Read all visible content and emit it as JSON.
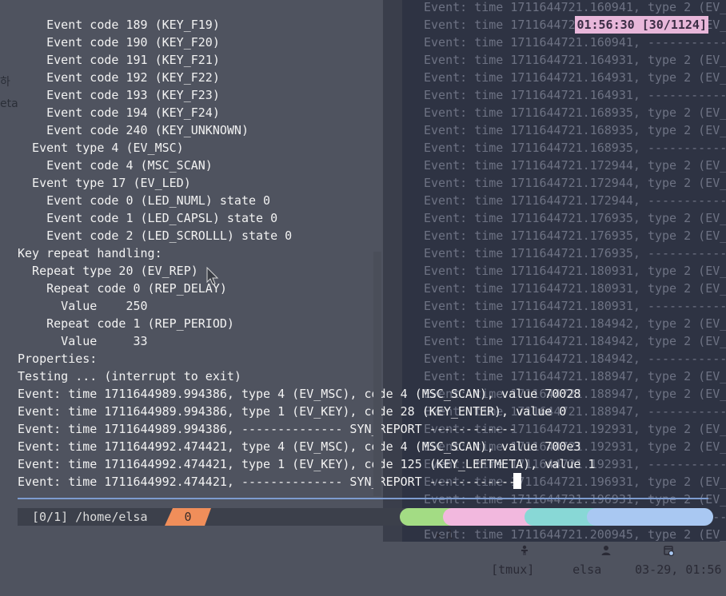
{
  "terminal": {
    "lines": [
      "    Event code 189 (KEY_F19)",
      "    Event code 190 (KEY_F20)",
      "    Event code 191 (KEY_F21)",
      "    Event code 192 (KEY_F22)",
      "    Event code 193 (KEY_F23)",
      "    Event code 194 (KEY_F24)",
      "    Event code 240 (KEY_UNKNOWN)",
      "  Event type 4 (EV_MSC)",
      "    Event code 4 (MSC_SCAN)",
      "  Event type 17 (EV_LED)",
      "    Event code 0 (LED_NUML) state 0",
      "    Event code 1 (LED_CAPSL) state 0",
      "    Event code 2 (LED_SCROLLL) state 0",
      "Key repeat handling:",
      "  Repeat type 20 (EV_REP)",
      "    Repeat code 0 (REP_DELAY)",
      "      Value    250",
      "    Repeat code 1 (REP_PERIOD)",
      "      Value     33",
      "Properties:",
      "Testing ... (interrupt to exit)",
      "Event: time 1711644989.994386, type 4 (EV_MSC), code 4 (MSC_SCAN), value 70028",
      "Event: time 1711644989.994386, type 1 (EV_KEY), code 28 (KEY_ENTER), value 0",
      "Event: time 1711644989.994386, -------------- SYN_REPORT ------------",
      "Event: time 1711644992.474421, type 4 (EV_MSC), code 4 (MSC_SCAN), value 700e3",
      "Event: time 1711644992.474421, type 1 (EV_KEY), code 125 (KEY_LEFTMETA), value 1",
      "Event: time 1711644992.474421, -------------- SYN_REPORT ------------"
    ]
  },
  "background_terminal": {
    "clock": "01:56:30 [30/1124]",
    "lines": [
      "Event: time 1711644721.160941, type 2 (EV_",
      "Event: time 1711644721.160941, type 2 (EV_",
      "Event: time 1711644721.160941, -----------",
      "Event: time 1711644721.164931, type 2 (EV_",
      "Event: time 1711644721.164931, type 2 (EV_",
      "Event: time 1711644721.164931, -----------",
      "Event: time 1711644721.168935, type 2 (EV_",
      "Event: time 1711644721.168935, type 2 (EV_",
      "Event: time 1711644721.168935, -----------",
      "Event: time 1711644721.172944, type 2 (EV_",
      "Event: time 1711644721.172944, type 2 (EV_",
      "Event: time 1711644721.172944, -----------",
      "Event: time 1711644721.176935, type 2 (EV_",
      "Event: time 1711644721.176935, type 2 (EV_",
      "Event: time 1711644721.176935, -----------",
      "Event: time 1711644721.180931, type 2 (EV_",
      "Event: time 1711644721.180931, type 2 (EV_",
      "Event: time 1711644721.180931, -----------",
      "Event: time 1711644721.184942, type 2 (EV_",
      "Event: time 1711644721.184942, type 2 (EV_",
      "Event: time 1711644721.184942, -----------",
      "Event: time 1711644721.188947, type 2 (EV_",
      "Event: time 1711644721.188947, type 2 (EV_",
      "Event: time 1711644721.188947, -----------",
      "Event: time 1711644721.192931, type 2 (EV_",
      "Event: time 1711644721.192931, type 2 (EV_",
      "Event: time 1711644721.192931, -----------",
      "Event: time 1711644721.196931, type 2 (EV_",
      "Event: time 1711644721.196931, type 2 (EV_",
      "Event: time 1711644721.196931, -----------",
      "Event: time 1711644721.200945, type 2 (EV_"
    ]
  },
  "fragments": {
    "korean": "하",
    "eta": "eta"
  },
  "statusbar": {
    "session": "[0/1] /home/elsa",
    "window_index": "0",
    "panes": "1",
    "tmux": "[tmux]",
    "user": "elsa",
    "datetime": "03-29, 01:56"
  },
  "icons": {
    "panes": "terminal-icon",
    "tmux": "person-icon",
    "user": "user-icon",
    "datetime": "calendar-clock-icon"
  },
  "colors": {
    "terminal_bg": "#4f535f",
    "text": "#f2f2f2",
    "accent_orange": "#f08e5a",
    "accent_green": "#a3dc84",
    "accent_pink": "#f2b8de",
    "accent_teal": "#88d8d6",
    "accent_blue": "#a9c8f2"
  }
}
